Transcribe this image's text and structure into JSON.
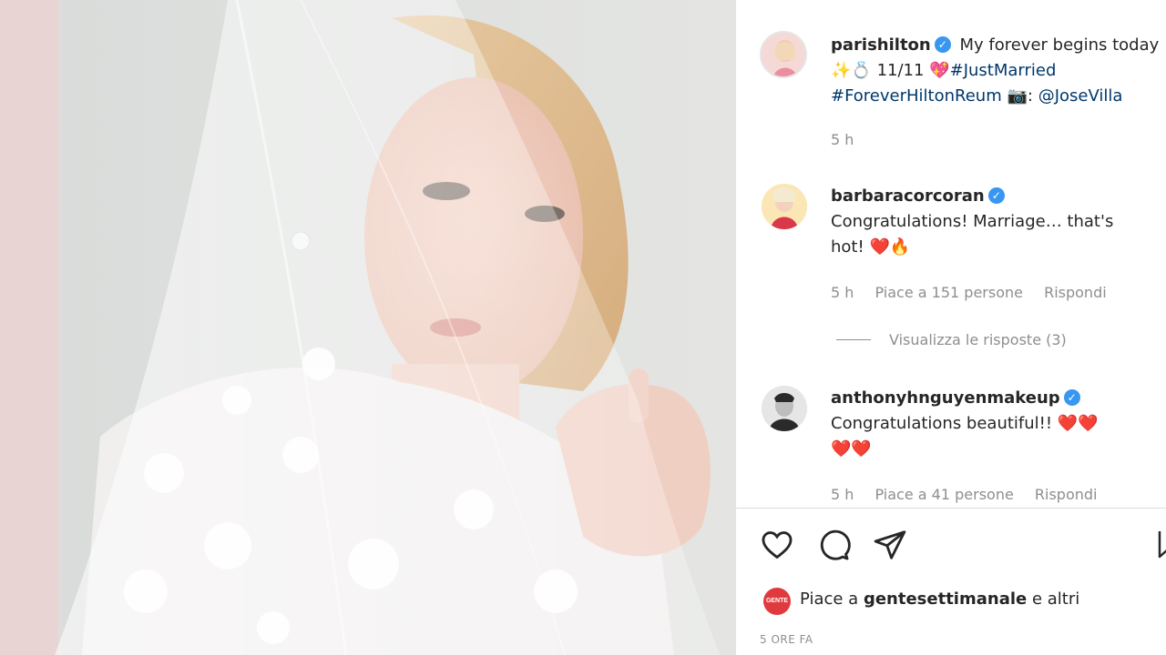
{
  "colors": {
    "accent": "#3897f0",
    "tag": "#00376b",
    "meta": "#8e8e8e",
    "heart": "#ed1c24"
  },
  "post": {
    "author": "parishilton",
    "caption_first": "My forever begins today",
    "date": "11/11",
    "hashtag_married": "#JustMarried",
    "hashtag_forever": "#ForeverHiltonReum",
    "photo_credit_sep": ":",
    "photo_credit": "@JoseVilla",
    "time": "5 h"
  },
  "comments": [
    {
      "user": "barbaracorcoran",
      "text_line1": "Congratulations! Marriage… that's",
      "text_line2": "hot!",
      "time": "5 h",
      "likes": "Piace a 151 persone",
      "reply": "Rispondi",
      "view_replies": "Visualizza le risposte (3)"
    },
    {
      "user": "anthonyhnguyenmakeup",
      "text_line1": "Congratulations beautiful!!",
      "time": "5 h",
      "likes": "Piace a 41 persone",
      "reply": "Rispondi"
    }
  ],
  "likes_bar": {
    "badge": "GENTE",
    "prefix": "Piace a",
    "account": "gentesettimanale",
    "suffix": "e altri"
  },
  "timestamp": "5 ORE FA",
  "icons": [
    "heart-icon",
    "comment-icon",
    "share-icon",
    "bookmark-icon",
    "verified-icon"
  ]
}
